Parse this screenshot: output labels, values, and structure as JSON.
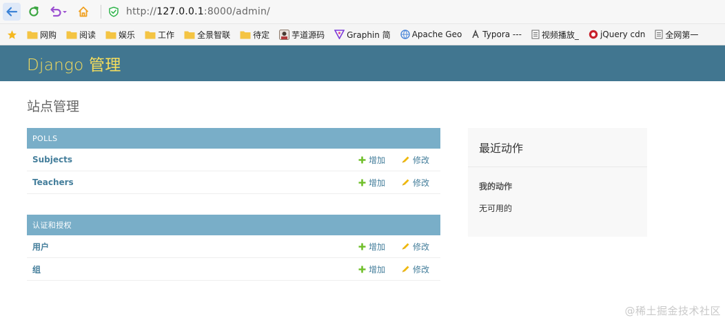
{
  "browser": {
    "url": {
      "scheme": "http://",
      "host": "127.0.0.1",
      "path": ":8000/admin/"
    },
    "bookmarks": [
      {
        "label": "网购",
        "icon": "folder-icon"
      },
      {
        "label": "阅读",
        "icon": "folder-icon"
      },
      {
        "label": "娱乐",
        "icon": "folder-icon"
      },
      {
        "label": "工作",
        "icon": "folder-icon"
      },
      {
        "label": "全景智联",
        "icon": "folder-icon"
      },
      {
        "label": "待定",
        "icon": "folder-icon"
      },
      {
        "label": "芋道源码",
        "icon": "avatar-icon"
      },
      {
        "label": "Graphin 简",
        "icon": "graphin-icon"
      },
      {
        "label": "Apache Geo",
        "icon": "globe-icon"
      },
      {
        "label": "Typora ---",
        "icon": "typora-icon"
      },
      {
        "label": "视频播放_",
        "icon": "page-icon"
      },
      {
        "label": "jQuery cdn",
        "icon": "jquery-icon"
      },
      {
        "label": "全网第一",
        "icon": "page-icon"
      }
    ]
  },
  "header": {
    "brand": "Django 管理"
  },
  "page": {
    "title": "站点管理"
  },
  "modules": [
    {
      "caption": "POLLS",
      "models": [
        {
          "name": "Subjects",
          "add": "增加",
          "change": "修改"
        },
        {
          "name": "Teachers",
          "add": "增加",
          "change": "修改"
        }
      ]
    },
    {
      "caption": "认证和授权",
      "models": [
        {
          "name": "用户",
          "add": "增加",
          "change": "修改"
        },
        {
          "name": "组",
          "add": "增加",
          "change": "修改"
        }
      ]
    }
  ],
  "recent": {
    "title": "最近动作",
    "subtitle": "我的动作",
    "empty": "无可用的"
  },
  "watermark": "@稀土掘金技术社区",
  "colors": {
    "header_bg": "#417690",
    "brand": "#f5dd5d",
    "caption_bg": "#79aec8",
    "link": "#447e9b",
    "add_green": "#70bf2b",
    "change_yellow": "#efb80b"
  }
}
